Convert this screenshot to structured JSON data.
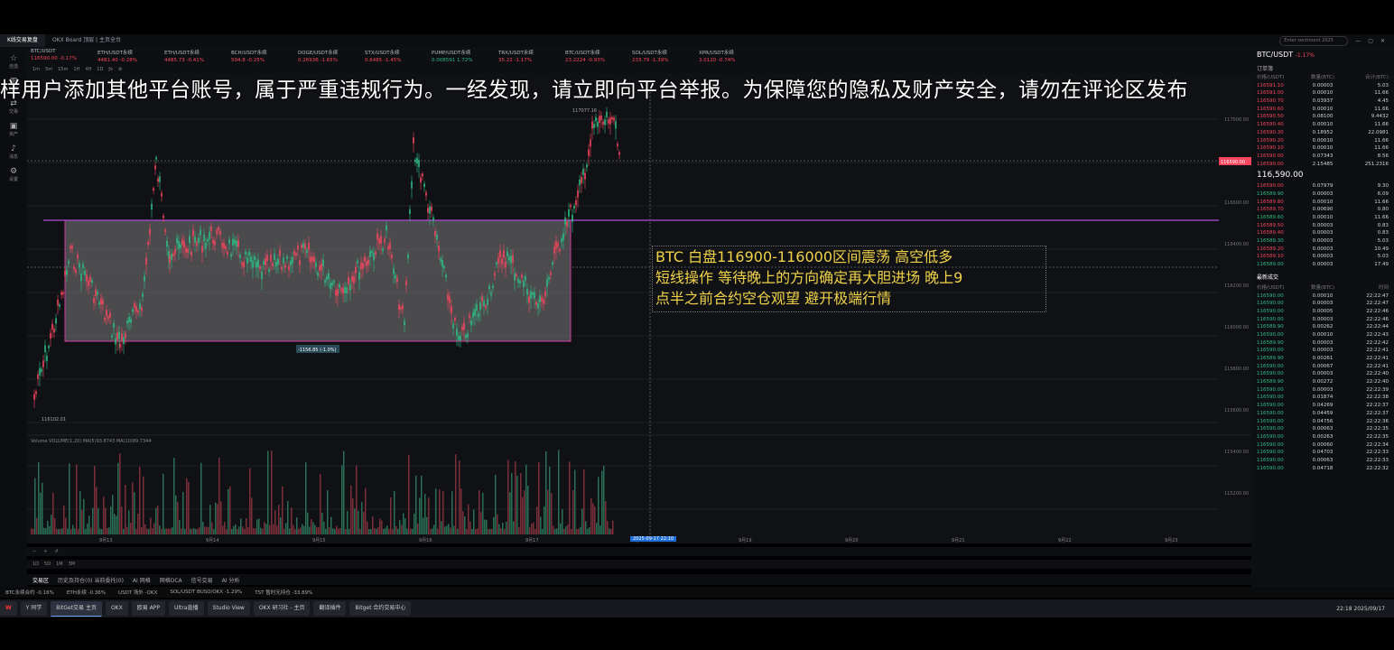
{
  "overlay_text": "样用户添加其他平台账号，属于严重违规行为。一经发现，请立即向平台举报。为保障您的隐私及财产安全，请勿在评论区发布",
  "tabbar": {
    "tabs": [
      "K线交易复盘",
      "OKX Board 顶层 | 主页全台"
    ],
    "search_placeholder": "Enter sentiment 2025"
  },
  "tickers": [
    {
      "symbol": "BTC/USDT",
      "price": "116590.00",
      "change": "-0.17%",
      "up": false
    },
    {
      "symbol": "ETH/USDT永续",
      "price": "4481.40",
      "change": "-0.28%",
      "up": false
    },
    {
      "symbol": "ETH/USDT永续",
      "price": "4485.73",
      "change": "-0.41%",
      "up": false
    },
    {
      "symbol": "BCH/USDT永续",
      "price": "594.8",
      "change": "-0.25%",
      "up": false
    },
    {
      "symbol": "DOGE/USDT永续",
      "price": "0.26936",
      "change": "-1.65%",
      "up": false
    },
    {
      "symbol": "STX/USDT永续",
      "price": "0.6485",
      "change": "-1.45%",
      "up": false
    },
    {
      "symbol": "PUMP/USDT永续",
      "price": "0.008591",
      "change": "1.72%",
      "up": true
    },
    {
      "symbol": "TRX/USDT永续",
      "price": "35.22",
      "change": "-1.17%",
      "up": false
    },
    {
      "symbol": "BTC/USDT永续",
      "price": "23.2224",
      "change": "-0.93%",
      "up": false
    },
    {
      "symbol": "SOL/USDT永续",
      "price": "233.79",
      "change": "-1.39%",
      "up": false
    },
    {
      "symbol": "XPR/USDT永续",
      "price": "3.0120",
      "change": "-0.74%",
      "up": false
    }
  ],
  "sidebar": [
    "自选",
    "行情",
    "交易",
    "资产",
    "消息",
    "设置"
  ],
  "annotation": {
    "lines": [
      "BTC  白盘116900-116000区间震荡   高空低多",
      "短线操作 等待晚上的方向确定再大胆进场 晚上9",
      "点半之前合约空仓观望 避开极端行情"
    ]
  },
  "chart": {
    "high_label": "117077.16",
    "low_label": "116102.01",
    "range_label": "-1156.85 (-1.0%)",
    "price_line_label": "116590.00",
    "volume_label": "Volume  VOLUME(1,20) MA(5)93.8743 MA(10)89.7344",
    "y_ticks": [
      "117000.00",
      "116800.00",
      "116600.00",
      "116400.00",
      "116200.00",
      "116000.00",
      "115800.00",
      "115600.00",
      "115400.00",
      "115200.00"
    ],
    "x_ticks": [
      "9月13",
      "9月14",
      "9月15",
      "9月16",
      "9月17",
      "9月18",
      "9月19",
      "9月20",
      "9月21",
      "9月22",
      "9月23"
    ],
    "current_time": "2025-09-17 22:10"
  },
  "right_panel": {
    "title": "BTC/USDT",
    "change": "-1.17%",
    "section": "订单簿",
    "headers": [
      "价格(USDT)",
      "数量(BTC)",
      "合计(BTC)"
    ],
    "asks": [
      [
        "116591.10",
        "0.00003",
        "5.03"
      ],
      [
        "116591.00",
        "0.00010",
        "11.66"
      ],
      [
        "116590.70",
        "0.03937",
        "4.45"
      ],
      [
        "116590.60",
        "0.00010",
        "11.66"
      ],
      [
        "116590.50",
        "0.08100",
        "9.4432"
      ],
      [
        "116590.40",
        "0.00010",
        "11.66"
      ],
      [
        "116590.30",
        "0.18952",
        "22.0981"
      ],
      [
        "116590.20",
        "0.00010",
        "11.66"
      ],
      [
        "116590.10",
        "0.00010",
        "11.66"
      ],
      [
        "116590.00",
        "0.07343",
        "8.56"
      ],
      [
        "116590.00",
        "2.15485",
        "251.2316"
      ]
    ],
    "last_price": "116,590.00",
    "bids": [
      [
        "116590.00",
        "0.07979",
        "9.30"
      ],
      [
        "116589.90",
        "0.00003",
        "6.09"
      ],
      [
        "116589.80",
        "0.00010",
        "11.66"
      ],
      [
        "116589.70",
        "0.00690",
        "0.80"
      ],
      [
        "116589.60",
        "0.00010",
        "11.66"
      ],
      [
        "116589.50",
        "0.00003",
        "0.83"
      ],
      [
        "116589.40",
        "0.00003",
        "0.83"
      ],
      [
        "116589.30",
        "0.00003",
        "5.03"
      ],
      [
        "116589.20",
        "0.00003",
        "10.49"
      ],
      [
        "116589.10",
        "0.00003",
        "5.03"
      ],
      [
        "116589.00",
        "0.00003",
        "17.49"
      ]
    ],
    "trades_title": "最新成交",
    "trade_headers": [
      "价格(USDT)",
      "数量(BTC)",
      "时间"
    ],
    "trades": [
      [
        "116590.00",
        "0.00010",
        "22:22:47"
      ],
      [
        "116590.00",
        "0.00003",
        "22:22:47"
      ],
      [
        "116590.00",
        "0.00005",
        "22:22:46"
      ],
      [
        "116590.00",
        "0.00003",
        "22:22:46"
      ],
      [
        "116589.90",
        "0.00262",
        "22:22:44"
      ],
      [
        "116590.00",
        "0.00010",
        "22:22:43"
      ],
      [
        "116589.90",
        "0.00003",
        "22:22:42"
      ],
      [
        "116590.00",
        "0.00003",
        "22:22:41"
      ],
      [
        "116589.90",
        "0.00261",
        "22:22:41"
      ],
      [
        "116590.00",
        "0.00067",
        "22:22:41"
      ],
      [
        "116590.00",
        "0.00003",
        "22:22:40"
      ],
      [
        "116589.90",
        "0.00272",
        "22:22:40"
      ],
      [
        "116590.00",
        "0.00003",
        "22:22:39"
      ],
      [
        "116590.00",
        "0.01874",
        "22:22:38"
      ],
      [
        "116590.00",
        "0.04269",
        "22:22:37"
      ],
      [
        "116590.00",
        "0.04459",
        "22:22:37"
      ],
      [
        "116590.00",
        "0.04756",
        "22:22:36"
      ],
      [
        "116590.00",
        "0.00063",
        "22:22:35"
      ],
      [
        "116590.00",
        "0.00263",
        "22:22:35"
      ],
      [
        "116590.00",
        "0.00060",
        "22:22:34"
      ],
      [
        "116590.00",
        "0.04703",
        "22:22:33"
      ],
      [
        "116590.00",
        "0.00063",
        "22:22:33"
      ],
      [
        "116590.00",
        "0.04718",
        "22:22:32"
      ]
    ]
  },
  "bottom_tabs": [
    "交易区",
    "历史及持仓(0) 当前委托(0)",
    "AI 网格",
    "网格DCA",
    "信号交易",
    "AI 分析"
  ],
  "status_bar": [
    "BTC永续合约 -0.16%",
    "ETH永续 -0.36%",
    "USDT 场外 -OKX",
    "SOL/USDT BUSD/OKX -1.29%",
    "TST 暂时无持仓 -33.89%"
  ],
  "taskbar": [
    "Y 同学",
    "BitGet交易 主页",
    "OKX",
    "欧易 APP",
    "Ultra直播",
    "Studio View",
    "OKX 研习社 - 主页",
    "翻译插件",
    "Bitget 合约交易中心"
  ],
  "clock": "22:18 2025/09/17"
}
